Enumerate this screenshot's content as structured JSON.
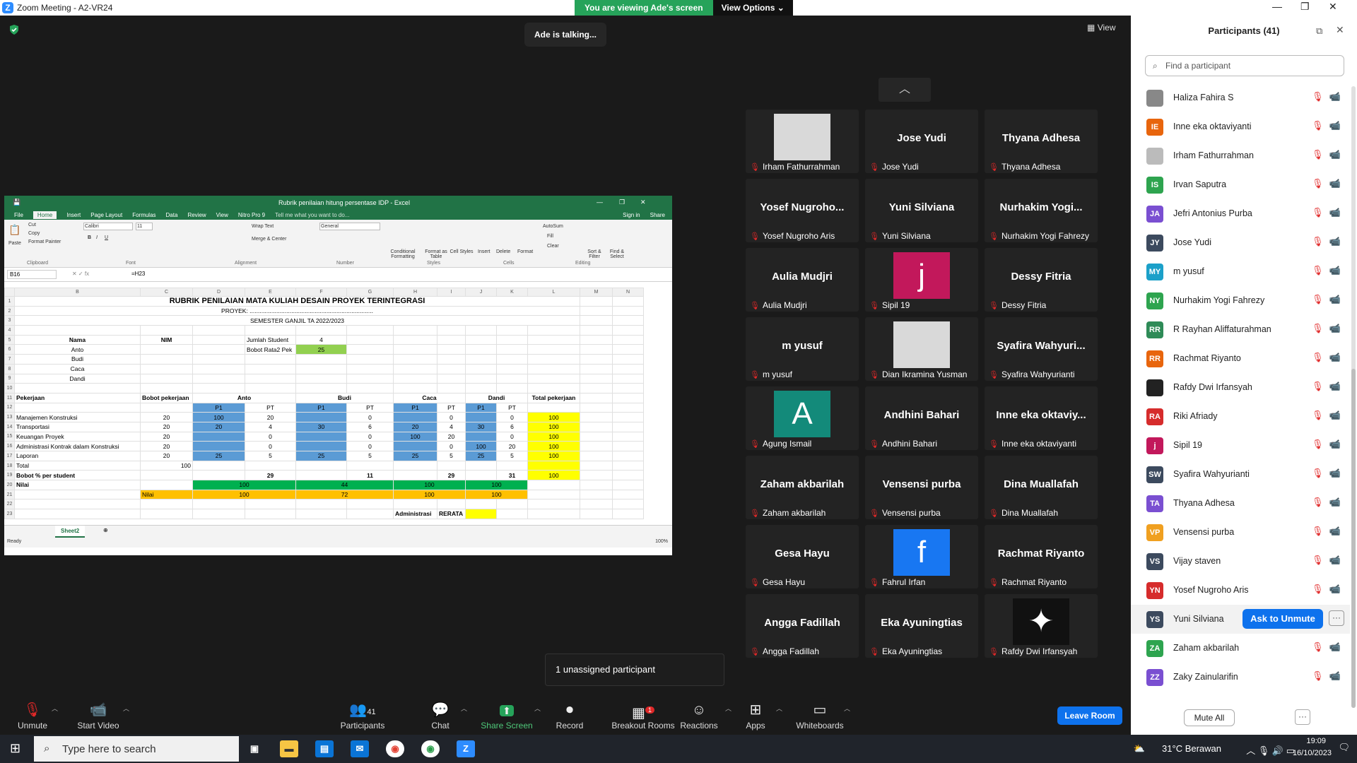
{
  "window": {
    "title": "Zoom Meeting - A2-VR24"
  },
  "banner": {
    "viewing": "You are viewing Ade's screen",
    "view_options": "View Options"
  },
  "talking": "Ade is talking...",
  "view_button": "View",
  "excel": {
    "title": "Rubrik penilaian hitung persentase IDP - Excel",
    "tabs": [
      "File",
      "Home",
      "Insert",
      "Page Layout",
      "Formulas",
      "Data",
      "Review",
      "View",
      "Nitro Pro 9"
    ],
    "tell_me": "Tell me what you want to do...",
    "signin": "Sign in",
    "share": "Share",
    "ribbon": {
      "cut": "Cut",
      "copy": "Copy",
      "format_painter": "Format Painter",
      "paste": "Paste",
      "font": "Calibri",
      "size": "11",
      "wrap": "Wrap Text",
      "merge": "Merge & Center",
      "numfmt": "General",
      "cond": "Conditional Formatting",
      "fmt_table": "Format as Table",
      "cell_styles": "Cell Styles",
      "insert": "Insert",
      "delete": "Delete",
      "format": "Format",
      "autosum": "AutoSum",
      "fill": "Fill",
      "clear": "Clear",
      "sort": "Sort & Filter",
      "find": "Find & Select",
      "g_clip": "Clipboard",
      "g_font": "Font",
      "g_align": "Alignment",
      "g_num": "Number",
      "g_styles": "Styles",
      "g_cells": "Cells",
      "g_edit": "Editing"
    },
    "namebox": "B16",
    "formula": "=H23",
    "cols": [
      "B",
      "C",
      "D",
      "E",
      "F",
      "G",
      "H",
      "I",
      "J",
      "K",
      "L",
      "M",
      "N"
    ],
    "sheet": "Sheet2",
    "status": "Ready",
    "zoom": "100%",
    "cells": {
      "r1": "RUBRIK PENILAIAN MATA KULIAH DESAIN PROYEK TERINTEGRASI",
      "r2": "PROYEK: ..........................................................................",
      "r3": "SEMESTER GANJIL TA 2022/2023",
      "nama": "Nama",
      "nim": "NIM",
      "jumlah": "Jumlah Student",
      "jumlah_v": "4",
      "bobot": "Bobot Rata2 Pek",
      "bobot_v": "25",
      "names": [
        "Anto",
        "Budi",
        "Caca",
        "Dandi"
      ],
      "pekerjaan": "Pekerjaan",
      "bobot_pek": "Bobot pekerjaan",
      "total_pek": "Total pekerjaan",
      "p1": "P1",
      "pt": "PT",
      "rows": [
        {
          "n": "Manajemen Konstruksi",
          "b": "20",
          "v": [
            "100",
            "20",
            "",
            "0",
            "",
            "0",
            "",
            "0"
          ],
          "t": "100"
        },
        {
          "n": "Transportasi",
          "b": "20",
          "v": [
            "20",
            "4",
            "30",
            "6",
            "20",
            "4",
            "30",
            "6"
          ],
          "t": "100"
        },
        {
          "n": "Keuangan Proyek",
          "b": "20",
          "v": [
            "",
            "0",
            "",
            "0",
            "100",
            "20",
            "",
            "0"
          ],
          "t": "100"
        },
        {
          "n": "Administrasi Kontrak dalam Konstruksi",
          "b": "20",
          "v": [
            "",
            "0",
            "",
            "0",
            "",
            "0",
            "100",
            "20"
          ],
          "t": "100"
        },
        {
          "n": "Laporan",
          "b": "20",
          "v": [
            "25",
            "5",
            "25",
            "5",
            "25",
            "5",
            "25",
            "5"
          ],
          "t": "100"
        }
      ],
      "total": "Total",
      "total_v": "100",
      "bobot_pct": "Bobot % per student",
      "bp": [
        "29",
        "11",
        "29",
        "31"
      ],
      "bp_t": "100",
      "nilai": "Nilai",
      "nilai_g": [
        "100",
        "44",
        "100",
        "100"
      ],
      "nilai2": "Nilai",
      "nilai_o": [
        "100",
        "72",
        "100",
        "100"
      ],
      "admin": "Administrasi",
      "rerata": "RERATA"
    }
  },
  "tiles": [
    {
      "name": "",
      "label": "Irham Fathurrahman",
      "img": "photo"
    },
    {
      "name": "Jose Yudi",
      "label": "Jose Yudi"
    },
    {
      "name": "Thyana Adhesa",
      "label": "Thyana Adhesa"
    },
    {
      "name": "Yosef Nugroho...",
      "label": "Yosef Nugroho Aris"
    },
    {
      "name": "Yuni Silviana",
      "label": "Yuni Silviana"
    },
    {
      "name": "Nurhakim Yogi...",
      "label": "Nurhakim Yogi Fahrezy"
    },
    {
      "name": "Aulia Mudjri",
      "label": "Aulia Mudjri"
    },
    {
      "name": "",
      "label": "Sipil 19",
      "img": "j"
    },
    {
      "name": "Dessy Fitria",
      "label": "Dessy Fitria"
    },
    {
      "name": "m yusuf",
      "label": "m yusuf"
    },
    {
      "name": "",
      "label": "Dian Ikramina Yusman",
      "img": "photo"
    },
    {
      "name": "Syafira Wahyuri...",
      "label": "Syafira Wahyurianti"
    },
    {
      "name": "",
      "label": "Agung Ismail",
      "img": "A"
    },
    {
      "name": "Andhini Bahari",
      "label": "Andhini Bahari"
    },
    {
      "name": "Inne eka oktaviy...",
      "label": "Inne eka oktaviyanti"
    },
    {
      "name": "Zaham akbarilah",
      "label": "Zaham akbarilah"
    },
    {
      "name": "Vensensi purba",
      "label": "Vensensi purba"
    },
    {
      "name": "Dina Muallafah",
      "label": "Dina Muallafah"
    },
    {
      "name": "Gesa Hayu",
      "label": "Gesa Hayu"
    },
    {
      "name": "",
      "label": "Fahrul Irfan",
      "img": "f"
    },
    {
      "name": "Rachmat Riyanto",
      "label": "Rachmat Riyanto"
    },
    {
      "name": "Angga Fadillah",
      "label": "Angga Fadillah"
    },
    {
      "name": "Eka Ayuningtias",
      "label": "Eka Ayuningtias"
    },
    {
      "name": "",
      "label": "Rafdy Dwi Irfansyah",
      "img": "logo"
    }
  ],
  "unassigned": "1 unassigned participant",
  "panel": {
    "title": "Participants (41)",
    "search_placeholder": "Find a participant",
    "participants": [
      {
        "i": "",
        "name": "Haliza Fahira S",
        "c": "#888"
      },
      {
        "i": "IE",
        "name": "Inne eka oktaviyanti",
        "c": "#e8650d"
      },
      {
        "i": "",
        "name": "Irham Fathurrahman",
        "c": "#bbb"
      },
      {
        "i": "IS",
        "name": "Irvan Saputra",
        "c": "#2ea44f"
      },
      {
        "i": "JA",
        "name": "Jefri Antonius Purba",
        "c": "#7a4fd1"
      },
      {
        "i": "JY",
        "name": "Jose Yudi",
        "c": "#3c4a5e"
      },
      {
        "i": "MY",
        "name": "m yusuf",
        "c": "#1ba0c9"
      },
      {
        "i": "NY",
        "name": "Nurhakim Yogi Fahrezy",
        "c": "#2ea44f"
      },
      {
        "i": "RR",
        "name": "R Rayhan Aliffaturahman",
        "c": "#2e8b57"
      },
      {
        "i": "RR",
        "name": "Rachmat Riyanto",
        "c": "#e8650d"
      },
      {
        "i": "",
        "name": "Rafdy Dwi Irfansyah",
        "c": "#222"
      },
      {
        "i": "RA",
        "name": "Riki Afriady",
        "c": "#d62c2c"
      },
      {
        "i": "j",
        "name": "Sipil 19",
        "c": "#c2185b"
      },
      {
        "i": "SW",
        "name": "Syafira Wahyurianti",
        "c": "#3c4a5e"
      },
      {
        "i": "TA",
        "name": "Thyana Adhesa",
        "c": "#7a4fd1"
      },
      {
        "i": "VP",
        "name": "Vensensi purba",
        "c": "#f0a020"
      },
      {
        "i": "VS",
        "name": "Vijay staven",
        "c": "#3c4a5e"
      },
      {
        "i": "YN",
        "name": "Yosef Nugroho Aris",
        "c": "#d62c2c"
      },
      {
        "i": "YS",
        "name": "Yuni Silviana",
        "c": "#3c4a5e"
      },
      {
        "i": "ZA",
        "name": "Zaham akbarilah",
        "c": "#2ea44f"
      },
      {
        "i": "ZZ",
        "name": "Zaky Zainularifin",
        "c": "#7a4fd1"
      }
    ],
    "ask_unmute": "Ask to Unmute",
    "mute_all": "Mute All"
  },
  "toolbar": {
    "unmute": "Unmute",
    "start_video": "Start Video",
    "participants": "Participants",
    "participants_count": "41",
    "chat": "Chat",
    "share": "Share Screen",
    "record": "Record",
    "breakout": "Breakout Rooms",
    "breakout_badge": "1",
    "reactions": "Reactions",
    "apps": "Apps",
    "whiteboards": "Whiteboards",
    "leave": "Leave Room"
  },
  "taskbar": {
    "search": "Type here to search",
    "weather": "31°C  Berawan",
    "time": "19:09",
    "date": "16/10/2023"
  }
}
